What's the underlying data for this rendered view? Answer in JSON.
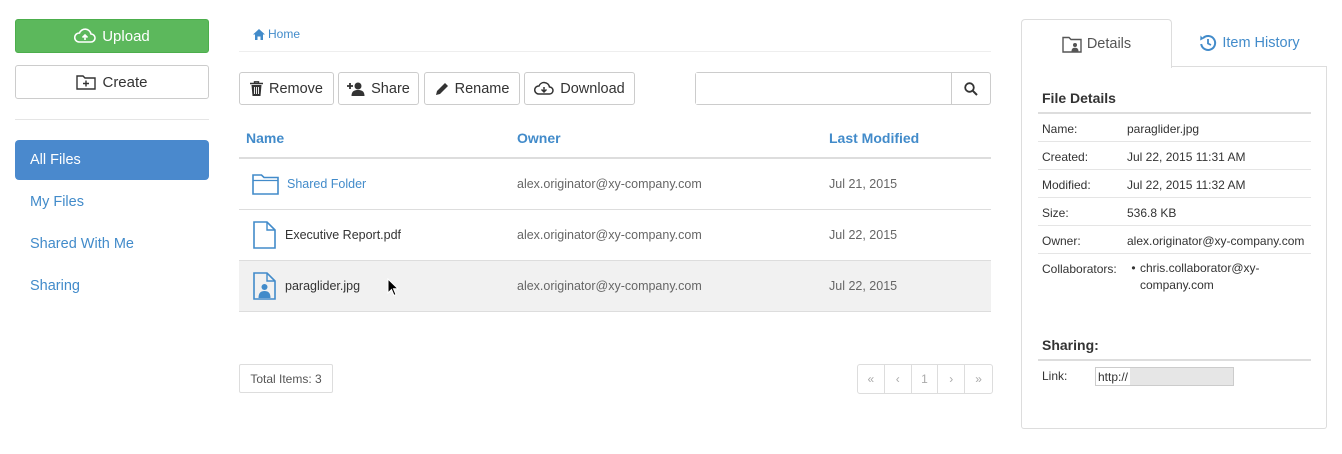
{
  "sidebar": {
    "upload_label": "Upload",
    "create_label": "Create",
    "items": [
      {
        "label": "All Files"
      },
      {
        "label": "My Files"
      },
      {
        "label": "Shared With Me"
      },
      {
        "label": "Sharing"
      }
    ]
  },
  "breadcrumb": {
    "home_label": "Home"
  },
  "toolbar": {
    "remove_label": "Remove",
    "share_label": "Share",
    "rename_label": "Rename",
    "download_label": "Download",
    "search_value": ""
  },
  "table": {
    "columns": [
      "Name",
      "Owner",
      "Last Modified"
    ],
    "rows": [
      {
        "icon": "folder-icon",
        "name": "Shared Folder",
        "owner": "alex.originator@xy-company.com",
        "modified": "Jul 21, 2015"
      },
      {
        "icon": "file-icon",
        "name": "Executive Report.pdf",
        "owner": "alex.originator@xy-company.com",
        "modified": "Jul 22, 2015"
      },
      {
        "icon": "image-file-icon",
        "name": "paraglider.jpg",
        "owner": "alex.originator@xy-company.com",
        "modified": "Jul 22, 2015"
      }
    ]
  },
  "footer": {
    "total_label": "Total Items: 3",
    "pager": [
      "«",
      "‹",
      "1",
      "›",
      "»"
    ]
  },
  "details": {
    "tab_details": "Details",
    "tab_history": "Item History",
    "file_details_title": "File Details",
    "fields": [
      {
        "label": "Name:",
        "value": "paraglider.jpg"
      },
      {
        "label": "Created:",
        "value": "Jul 22, 2015 11:31 AM"
      },
      {
        "label": "Modified:",
        "value": "Jul 22, 2015 11:32 AM"
      },
      {
        "label": "Size:",
        "value": "536.8 KB"
      },
      {
        "label": "Owner:",
        "value": "alex.originator@xy-company.com"
      }
    ],
    "collaborators_label": "Collaborators:",
    "collaborators": [
      "chris.collaborator@xy-company.com"
    ],
    "sharing_title": "Sharing:",
    "link_label": "Link:",
    "link_value": "http://"
  },
  "colors": {
    "primary": "#428bca",
    "success": "#5cb85c",
    "active_nav": "#4a89cd"
  }
}
